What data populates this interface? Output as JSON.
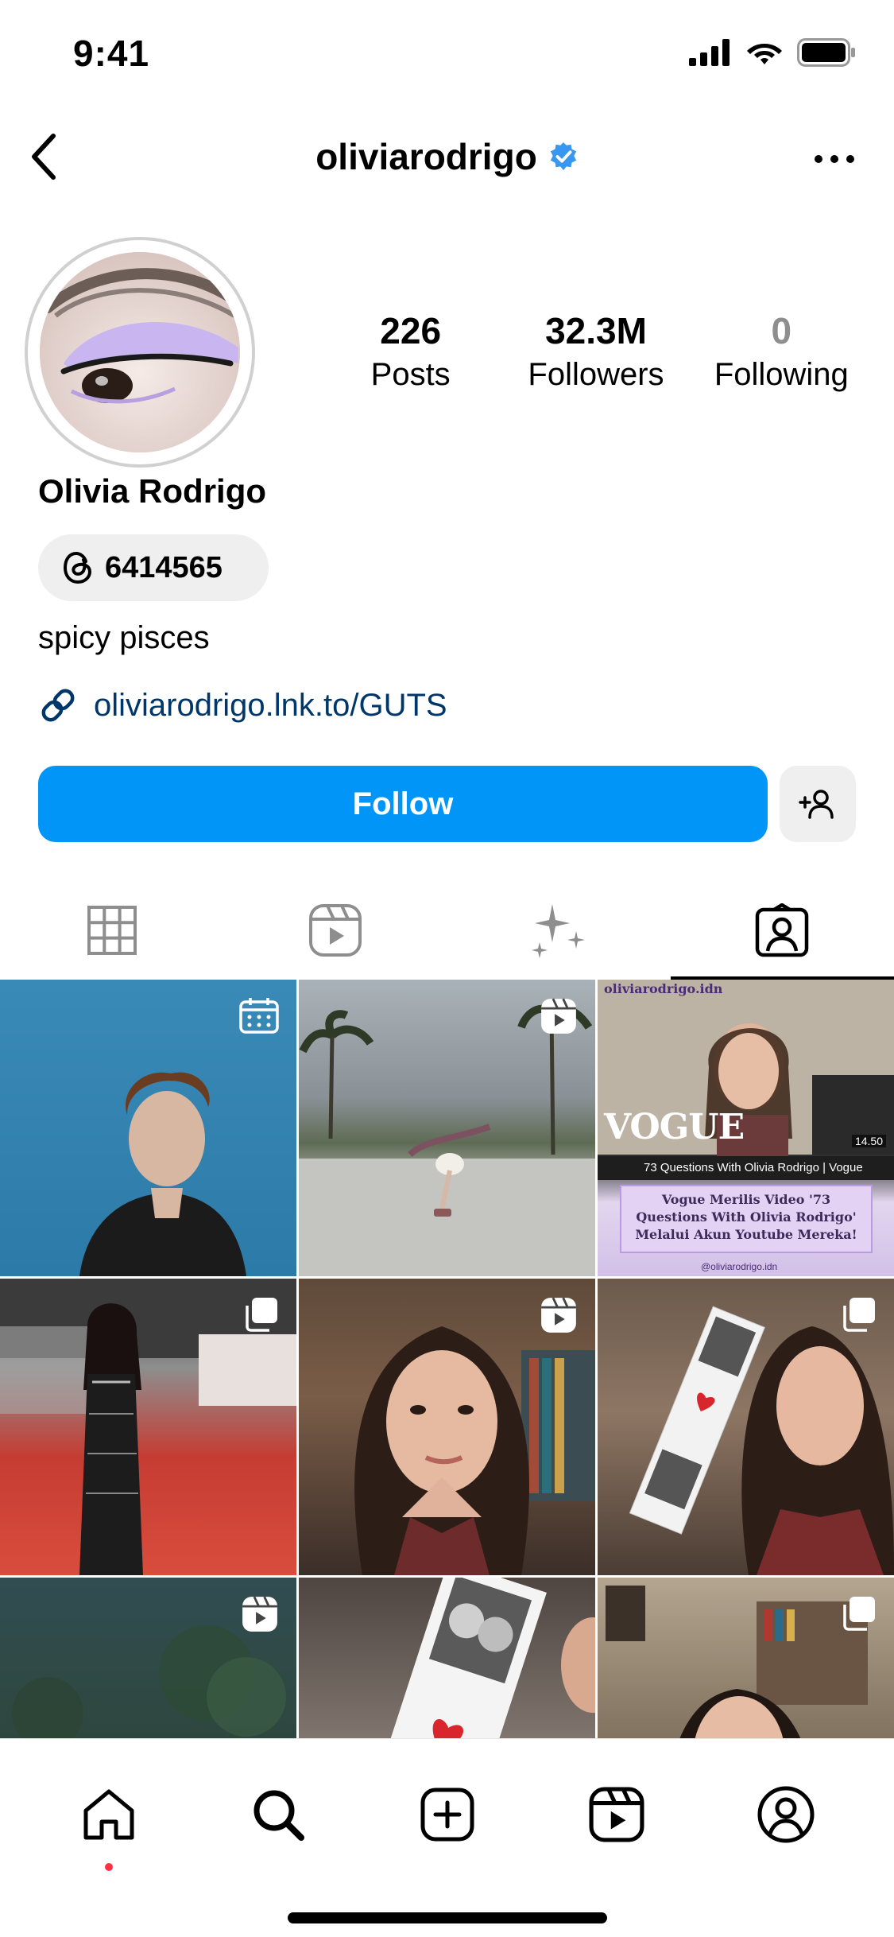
{
  "status_bar": {
    "time": "9:41"
  },
  "header": {
    "username": "oliviarodrigo",
    "verified": true
  },
  "profile": {
    "full_name": "Olivia Rodrigo",
    "threads_count": "6414565",
    "bio": "spicy pisces",
    "link": "oliviarodrigo.lnk.to/GUTS",
    "stats": [
      {
        "value": "226",
        "label": "Posts"
      },
      {
        "value": "32.3M",
        "label": "Followers"
      },
      {
        "value": "0",
        "label": "Following"
      }
    ]
  },
  "actions": {
    "follow_label": "Follow"
  },
  "colors": {
    "accent": "#0095f6",
    "link": "#00376b",
    "verified": "#3897f0",
    "notification": "#ff3040"
  },
  "tabs": [
    "grid-icon",
    "reels-icon",
    "sparkles-icon",
    "tagged-icon"
  ],
  "grid": {
    "vogue_post": {
      "handle": "oliviarodrigo.idn",
      "brand": "VOGUE",
      "duration": "14.50",
      "video_title": "73 Questions With Olivia Rodrigo | Vogue",
      "caption": "Vogue Merilis Video '73 Questions With Olivia Rodrigo' Melalui Akun Youtube Mereka!",
      "footer_handle": "@oliviarodrigo.idn"
    }
  }
}
